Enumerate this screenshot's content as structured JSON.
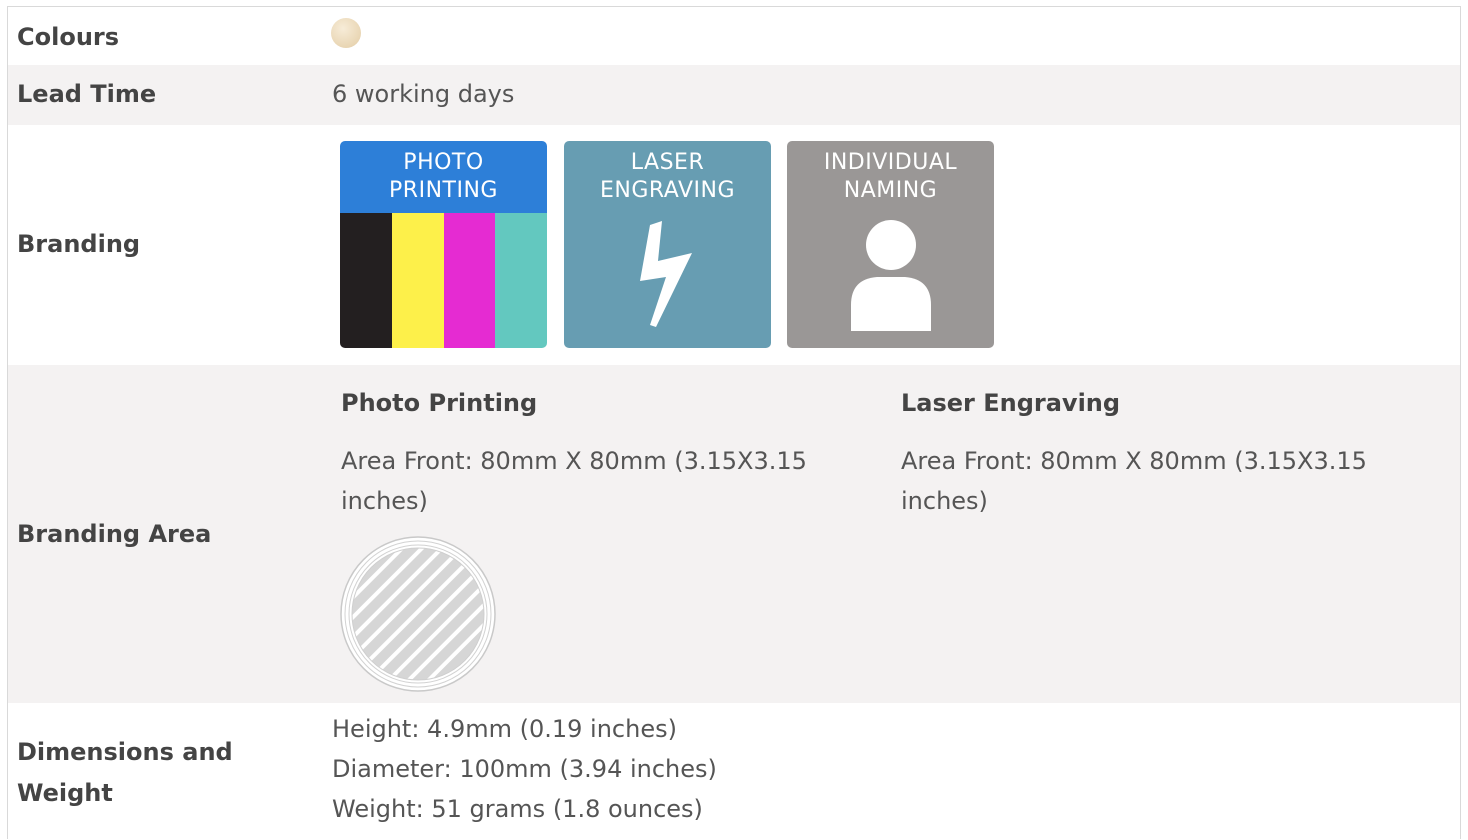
{
  "rows": {
    "colours": {
      "label": "Colours",
      "swatch_color": "#ecdcbf"
    },
    "lead_time": {
      "label": "Lead Time",
      "value": "6 working days"
    },
    "branding": {
      "label": "Branding",
      "tiles": [
        {
          "title_line1": "PHOTO",
          "title_line2": "PRINTING",
          "color": "#2d7fd8",
          "bars": [
            "#231f20",
            "#fdf04a",
            "#e52bd2",
            "#63c8bf"
          ]
        },
        {
          "title_line1": "LASER",
          "title_line2": "ENGRAVING",
          "color": "#679db2",
          "icon": "lightning-bolt-icon"
        },
        {
          "title_line1": "INDIVIDUAL",
          "title_line2": "NAMING",
          "color": "#9a9796",
          "icon": "person-icon"
        }
      ]
    },
    "branding_area": {
      "label": "Branding Area",
      "methods": [
        {
          "title": "Photo Printing",
          "detail": "Area Front: 80mm X 80mm (3.15X3.15 inches)"
        },
        {
          "title": "Laser Engraving",
          "detail": "Area Front: 80mm X 80mm (3.15X3.15 inches)"
        }
      ]
    },
    "dimensions": {
      "label": "Dimensions and Weight",
      "height": "Height: 4.9mm (0.19 inches)",
      "diameter": "Diameter: 100mm (3.94 inches)",
      "weight": "Weight: 51 grams (1.8 ounces)"
    }
  }
}
